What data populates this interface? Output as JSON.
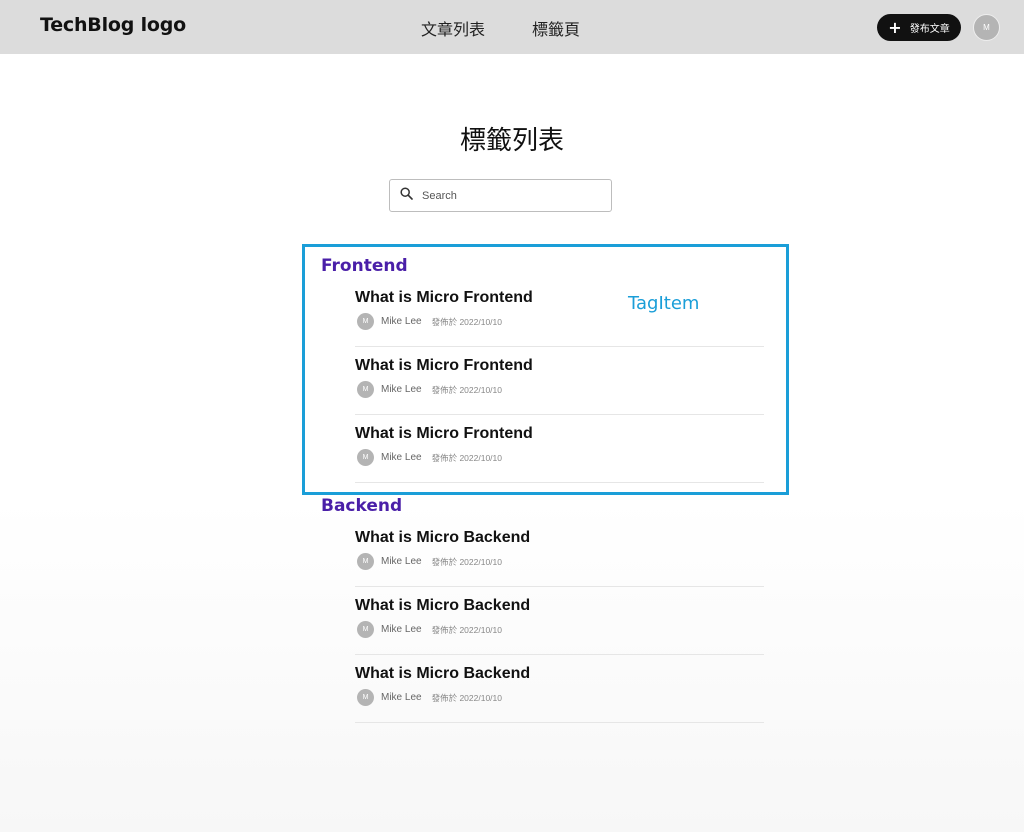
{
  "header": {
    "logo": "TechBlog logo",
    "nav": [
      "文章列表",
      "標籤頁"
    ],
    "publish_icon": "plus-icon",
    "publish_label": "發布文章",
    "avatar_initial": "M"
  },
  "page": {
    "title": "標籤列表",
    "search": {
      "icon": "search-icon",
      "placeholder": "Search",
      "value": ""
    }
  },
  "annotation": {
    "label": "TagItem",
    "color": "#1a9ed8"
  },
  "tags": [
    {
      "name": "Frontend",
      "articles": [
        {
          "title": "What is Micro Frontend",
          "avatar": "M",
          "author": "Mike Lee",
          "date": "發佈於 2022/10/10"
        },
        {
          "title": "What is Micro Frontend",
          "avatar": "M",
          "author": "Mike Lee",
          "date": "發佈於 2022/10/10"
        },
        {
          "title": "What is Micro Frontend",
          "avatar": "M",
          "author": "Mike Lee",
          "date": "發佈於 2022/10/10"
        }
      ]
    },
    {
      "name": "Backend",
      "articles": [
        {
          "title": "What is Micro Backend",
          "avatar": "M",
          "author": "Mike Lee",
          "date": "發佈於 2022/10/10"
        },
        {
          "title": "What is Micro Backend",
          "avatar": "M",
          "author": "Mike Lee",
          "date": "發佈於 2022/10/10"
        },
        {
          "title": "What is Micro Backend",
          "avatar": "M",
          "author": "Mike Lee",
          "date": "發佈於 2022/10/10"
        }
      ]
    }
  ],
  "colors": {
    "header_bg": "#dcdcdc",
    "tag_name": "#4a1fa8",
    "button_bg": "#111111",
    "avatar": "#b4b4b4"
  }
}
